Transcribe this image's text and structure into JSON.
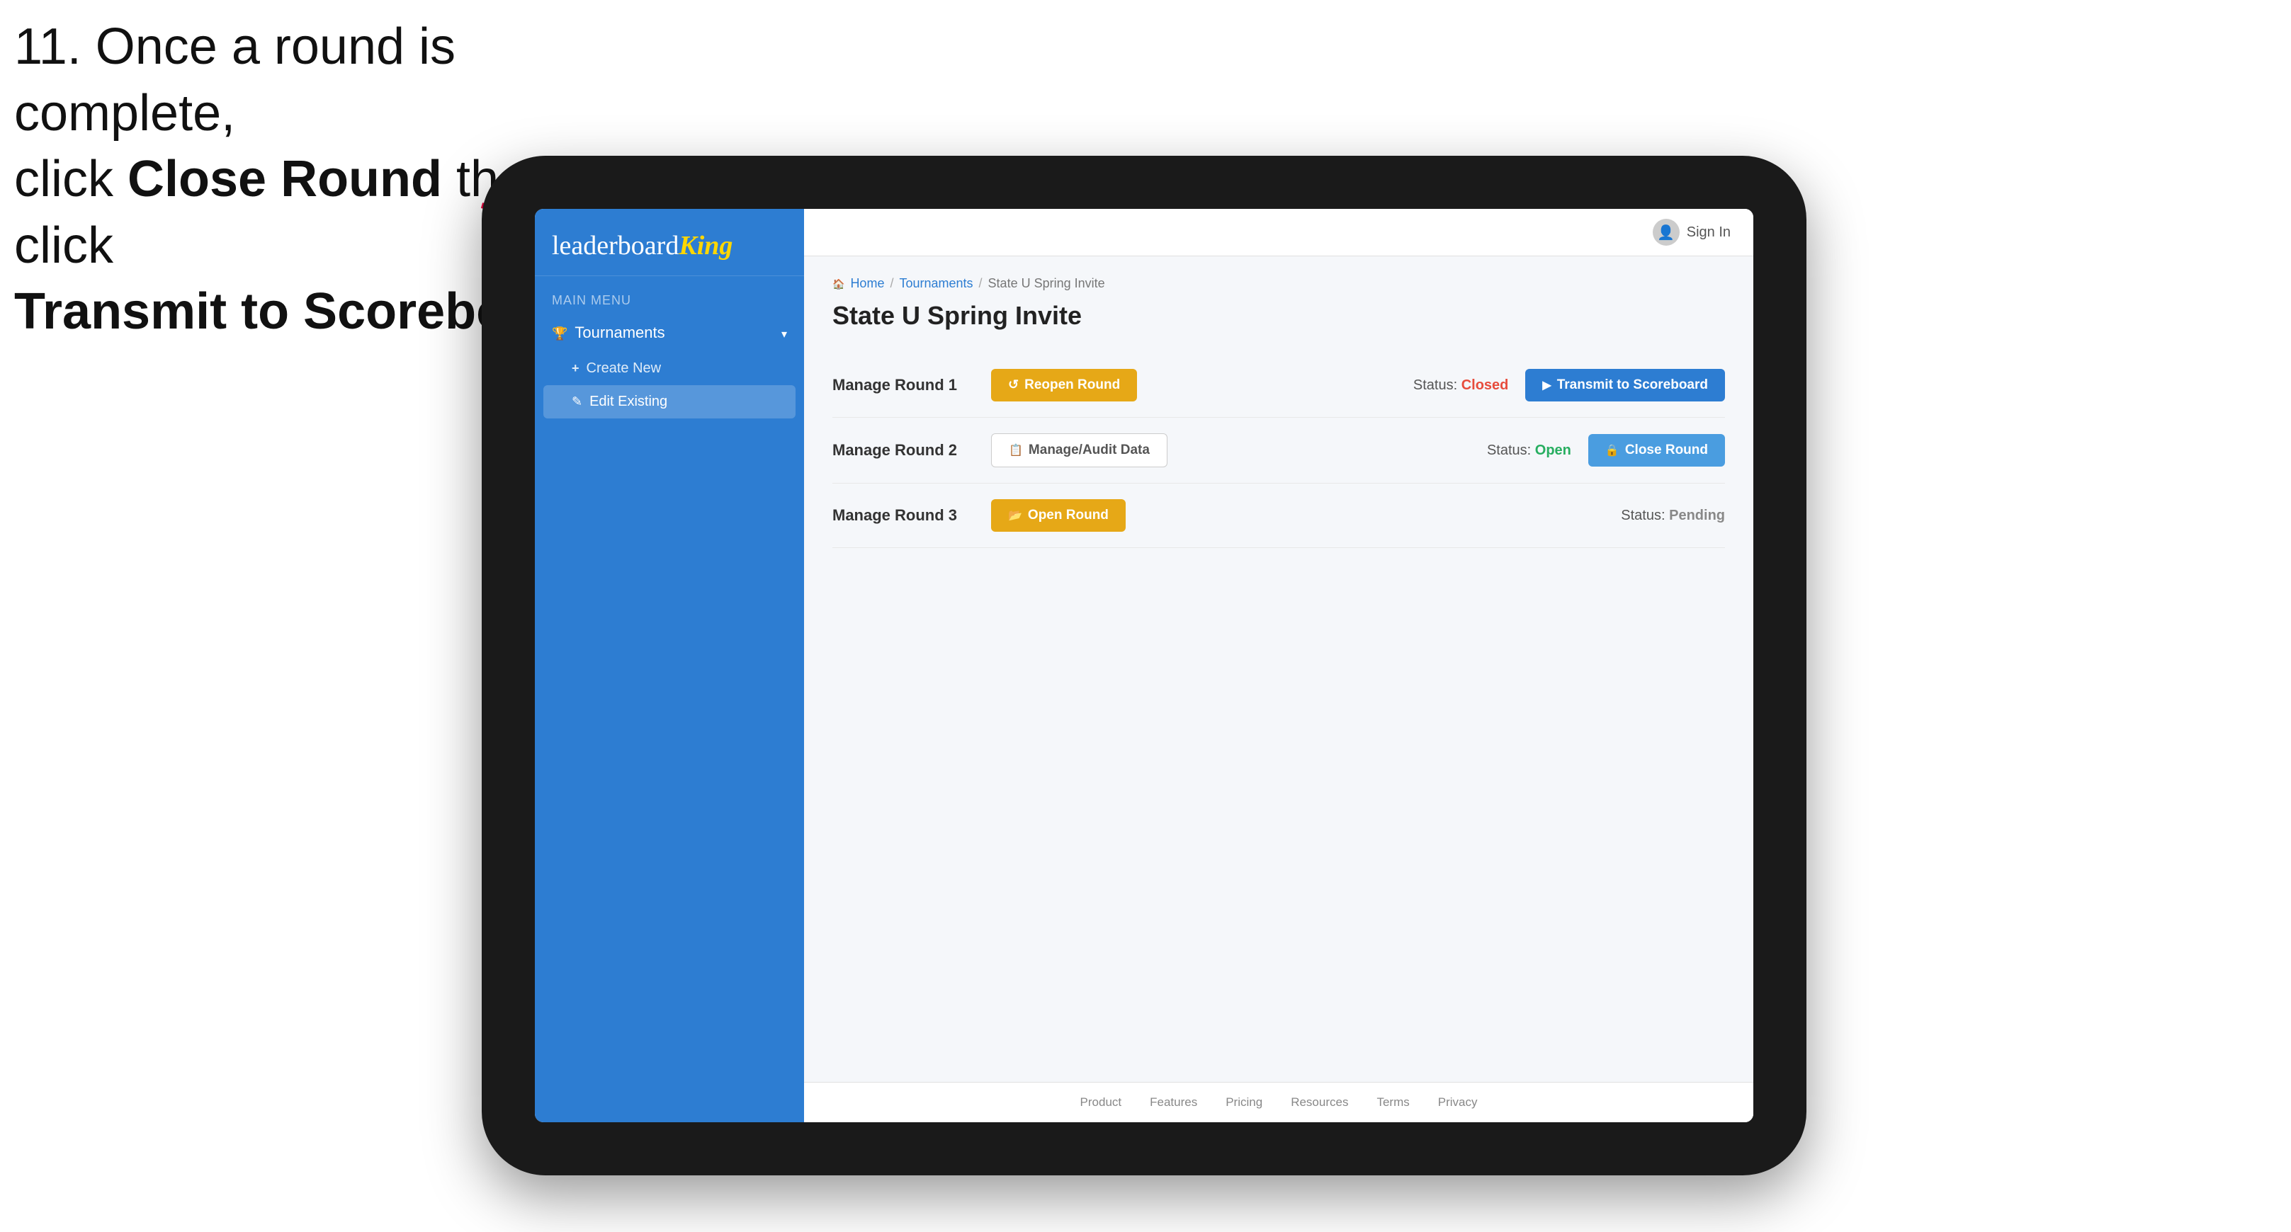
{
  "instruction": {
    "line1": "11. Once a round is complete,",
    "line2_prefix": "click ",
    "line2_bold": "Close Round",
    "line2_suffix": " then click",
    "line3_bold": "Transmit to Scoreboard."
  },
  "arrow": {
    "color": "#e8003d"
  },
  "tablet": {
    "header": {
      "sign_in_label": "Sign In"
    },
    "breadcrumb": {
      "home": "Home",
      "separator1": "/",
      "tournaments": "Tournaments",
      "separator2": "/",
      "current": "State U Spring Invite"
    },
    "page_title": "State U Spring Invite",
    "sidebar": {
      "logo_leaderboard": "leaderboard",
      "logo_king": "King",
      "menu_label": "MAIN MENU",
      "nav_items": [
        {
          "label": "Tournaments",
          "icon": "trophy-icon",
          "expanded": true,
          "sub_items": [
            {
              "label": "Create New",
              "icon": "plus-icon",
              "active": false
            },
            {
              "label": "Edit Existing",
              "icon": "edit-icon",
              "active": true
            }
          ]
        }
      ]
    },
    "rounds": [
      {
        "title": "Manage Round 1",
        "status_label": "Status:",
        "status_value": "Closed",
        "status_type": "closed",
        "buttons": [
          {
            "label": "Reopen Round",
            "type": "amber",
            "icon": "reopen-icon"
          },
          {
            "label": "Transmit to Scoreboard",
            "type": "blue",
            "icon": "transmit-icon"
          }
        ]
      },
      {
        "title": "Manage Round 2",
        "status_label": "Status:",
        "status_value": "Open",
        "status_type": "open",
        "buttons": [
          {
            "label": "Manage/Audit Data",
            "type": "outline",
            "icon": "audit-icon"
          },
          {
            "label": "Close Round",
            "type": "blue-light",
            "icon": "close-icon"
          }
        ]
      },
      {
        "title": "Manage Round 3",
        "status_label": "Status:",
        "status_value": "Pending",
        "status_type": "pending",
        "buttons": [
          {
            "label": "Open Round",
            "type": "amber",
            "icon": "open-icon"
          }
        ]
      }
    ],
    "footer_links": [
      "Product",
      "Features",
      "Pricing",
      "Resources",
      "Terms",
      "Privacy"
    ]
  }
}
